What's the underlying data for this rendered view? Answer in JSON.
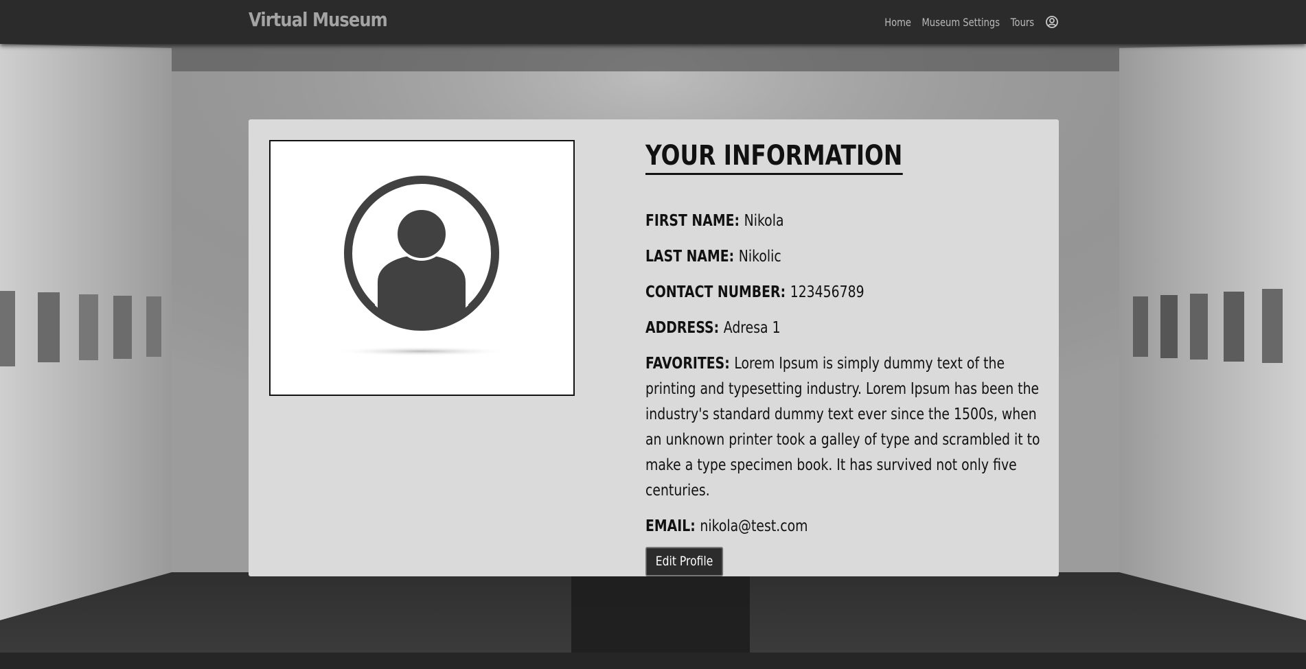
{
  "navbar": {
    "brand": "Virtual Museum",
    "links": [
      {
        "label": "Home"
      },
      {
        "label": "Museum Settings"
      },
      {
        "label": "Tours"
      }
    ],
    "user_icon": "user-circle-icon"
  },
  "profile": {
    "avatar_icon": "user-avatar-icon",
    "title": "YOUR INFORMATION",
    "fields": [
      {
        "label": "FIRST NAME:",
        "value": "Nikola"
      },
      {
        "label": "LAST NAME:",
        "value": "Nikolic"
      },
      {
        "label": "CONTACT NUMBER:",
        "value": "123456789"
      },
      {
        "label": "ADDRESS:",
        "value": "Adresa 1"
      },
      {
        "label": "FAVORITES:",
        "value": "Lorem Ipsum is simply dummy text of the printing and typesetting industry. Lorem Ipsum has been the industry's standard dummy text ever since the 1500s, when an unknown printer took a galley of type and scrambled it to make a type specimen book. It has survived not only five centuries."
      },
      {
        "label": "EMAIL:",
        "value": "nikola@test.com"
      }
    ],
    "edit_button": "Edit Profile"
  },
  "colors": {
    "navbar_bg": "#2b2b2b",
    "card_bg": "#dadada",
    "button_bg": "#2c2c2c",
    "text": "#111111"
  }
}
